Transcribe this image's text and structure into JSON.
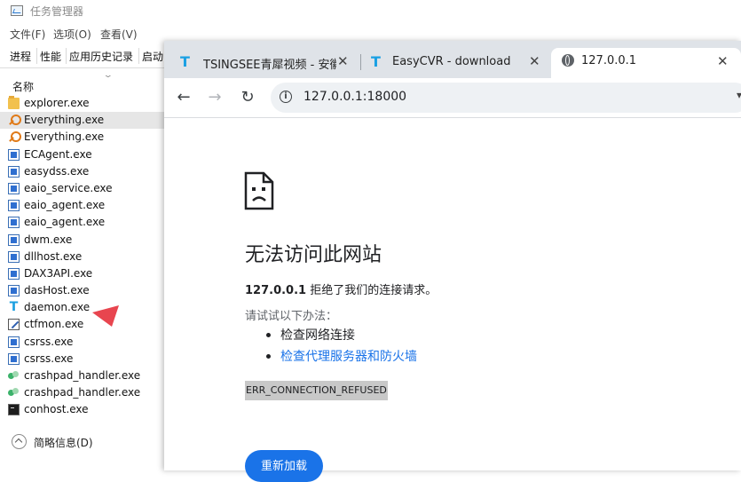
{
  "task_manager": {
    "title": "任务管理器",
    "menu": [
      "文件(F)",
      "选项(O)",
      "查看(V)"
    ],
    "tabs": [
      "进程",
      "性能",
      "应用历史记录",
      "启动"
    ],
    "column_header": "名称",
    "processes": [
      {
        "name": "explorer.exe",
        "icon": "folder-icon"
      },
      {
        "name": "Everything.exe",
        "icon": "search-icon",
        "selected": true
      },
      {
        "name": "Everything.exe",
        "icon": "search-icon"
      },
      {
        "name": "ECAgent.exe",
        "icon": "window-icon"
      },
      {
        "name": "easydss.exe",
        "icon": "window-icon"
      },
      {
        "name": "eaio_service.exe",
        "icon": "window-icon"
      },
      {
        "name": "eaio_agent.exe",
        "icon": "window-icon"
      },
      {
        "name": "eaio_agent.exe",
        "icon": "window-icon"
      },
      {
        "name": "dwm.exe",
        "icon": "window-icon"
      },
      {
        "name": "dllhost.exe",
        "icon": "window-icon"
      },
      {
        "name": "DAX3API.exe",
        "icon": "window-icon"
      },
      {
        "name": "dasHost.exe",
        "icon": "window-icon"
      },
      {
        "name": "daemon.exe",
        "icon": "t-logo-icon"
      },
      {
        "name": "ctfmon.exe",
        "icon": "ctfmon-icon"
      },
      {
        "name": "csrss.exe",
        "icon": "window-icon"
      },
      {
        "name": "csrss.exe",
        "icon": "window-icon"
      },
      {
        "name": "crashpad_handler.exe",
        "icon": "crashpad-icon"
      },
      {
        "name": "crashpad_handler.exe",
        "icon": "crashpad-icon"
      },
      {
        "name": "conhost.exe",
        "icon": "console-icon"
      }
    ],
    "footer": "简略信息(D)"
  },
  "browser": {
    "tabs": [
      {
        "title": "TSINGSEE青犀视频 - 安徽",
        "icon": "t-logo-icon"
      },
      {
        "title": "EasyCVR - download",
        "icon": "t-logo-icon"
      },
      {
        "title": "127.0.0.1",
        "icon": "globe-icon",
        "active": true
      }
    ],
    "address": "127.0.0.1:18000",
    "error": {
      "title": "无法访问此网站",
      "host": "127.0.0.1",
      "message": " 拒绝了我们的连接请求。",
      "try_label": "请试试以下办法：",
      "suggestions": [
        {
          "text": "检查网络连接",
          "link": false
        },
        {
          "text": "检查代理服务器和防火墙",
          "link": true
        }
      ],
      "code": "ERR_CONNECTION_REFUSED",
      "reload_label": "重新加载"
    }
  },
  "colors": {
    "accent": "#1a73e8",
    "annotation_arrow": "#e8454f",
    "tab_strip": "#dfe3e8"
  }
}
